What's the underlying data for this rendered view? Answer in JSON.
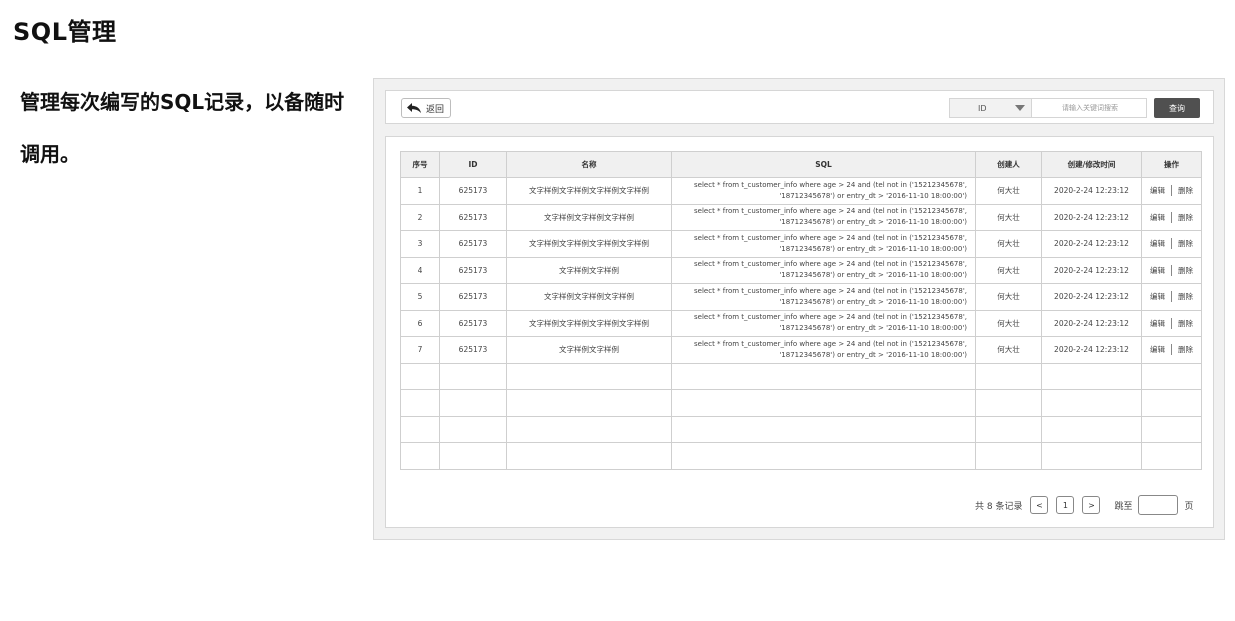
{
  "page": {
    "title": "SQL管理",
    "description": "管理每次编写的SQL记录，以备随时调用。"
  },
  "toolbar": {
    "back_label": "返回",
    "field_value": "ID",
    "search_placeholder": "请输入关键词搜索",
    "search_label": "查询"
  },
  "table": {
    "columns": [
      "序号",
      "ID",
      "名称",
      "SQL",
      "创建人",
      "创建/修改时间",
      "操作"
    ],
    "rows": [
      {
        "no": "1",
        "id": "625173",
        "name": "文字样例文字样例文字样例文字样例",
        "sql": "select * from t_customer_info where age > 24 and (tel not in ('15212345678', '18712345678') or entry_dt > '2016-11-10 18:00:00')",
        "creator": "何大壮",
        "time": "2020-2-24 12:23:12",
        "edit": "编辑",
        "delete": "删除"
      },
      {
        "no": "2",
        "id": "625173",
        "name": "文字样例文字样例文字样例",
        "sql": "select * from t_customer_info where age > 24 and (tel not in ('15212345678', '18712345678') or entry_dt > '2016-11-10 18:00:00')",
        "creator": "何大壮",
        "time": "2020-2-24 12:23:12",
        "edit": "编辑",
        "delete": "删除"
      },
      {
        "no": "3",
        "id": "625173",
        "name": "文字样例文字样例文字样例文字样例",
        "sql": "select * from t_customer_info where age > 24 and (tel not in ('15212345678', '18712345678') or entry_dt > '2016-11-10 18:00:00')",
        "creator": "何大壮",
        "time": "2020-2-24 12:23:12",
        "edit": "编辑",
        "delete": "删除"
      },
      {
        "no": "4",
        "id": "625173",
        "name": "文字样例文字样例",
        "sql": "select * from t_customer_info where age > 24 and (tel not in ('15212345678', '18712345678') or entry_dt > '2016-11-10 18:00:00')",
        "creator": "何大壮",
        "time": "2020-2-24 12:23:12",
        "edit": "编辑",
        "delete": "删除"
      },
      {
        "no": "5",
        "id": "625173",
        "name": "文字样例文字样例文字样例",
        "sql": "select * from t_customer_info where age > 24 and (tel not in ('15212345678', '18712345678') or entry_dt > '2016-11-10 18:00:00')",
        "creator": "何大壮",
        "time": "2020-2-24 12:23:12",
        "edit": "编辑",
        "delete": "删除"
      },
      {
        "no": "6",
        "id": "625173",
        "name": "文字样例文字样例文字样例文字样例",
        "sql": "select * from t_customer_info where age > 24 and (tel not in ('15212345678', '18712345678') or entry_dt > '2016-11-10 18:00:00')",
        "creator": "何大壮",
        "time": "2020-2-24 12:23:12",
        "edit": "编辑",
        "delete": "删除"
      },
      {
        "no": "7",
        "id": "625173",
        "name": "文字样例文字样例",
        "sql": "select * from t_customer_info where age > 24 and (tel not in ('15212345678', '18712345678') or entry_dt > '2016-11-10 18:00:00')",
        "creator": "何大壮",
        "time": "2020-2-24 12:23:12",
        "edit": "编辑",
        "delete": "删除"
      }
    ],
    "empty_rows": 4
  },
  "pagination": {
    "total_text": "共 8 条记录",
    "prev": "<",
    "current": "1",
    "next": ">",
    "jump_label": "跳至",
    "page_suffix": "页"
  },
  "icons": {
    "back": "back-arrow-icon",
    "dropdown": "chevron-down-icon"
  },
  "colors": {
    "search_button": "#505050",
    "frame_bg": "#f1f1f1",
    "header_bg": "#f0f0f0"
  }
}
